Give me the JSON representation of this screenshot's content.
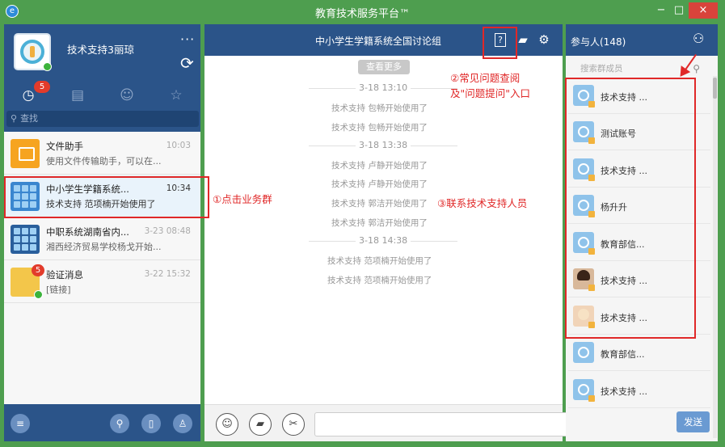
{
  "window": {
    "title": "教育技术服务平台™",
    "app_icon": "app-logo-icon",
    "controls": {
      "minimize": "−",
      "maximize": "□",
      "close": "×"
    },
    "accent_color": "#2b5489",
    "frame_color": "#4e9e4f"
  },
  "profile": {
    "name": "技术支持3丽琼",
    "more": "···",
    "refresh": "⟳"
  },
  "nav": {
    "tabs": [
      {
        "icon": "clock-icon",
        "glyph": "◷",
        "badge": "5"
      },
      {
        "icon": "list-icon",
        "glyph": "▤"
      },
      {
        "icon": "contacts-icon",
        "glyph": "☺"
      },
      {
        "icon": "star-icon",
        "glyph": "☆"
      }
    ]
  },
  "search": {
    "glyph": "⚲",
    "placeholder": "查找"
  },
  "conversations": [
    {
      "title": "文件助手",
      "snippet": "使用文件传输助手，可以在...",
      "time": "10:03",
      "icon": "file-helper-icon"
    },
    {
      "title": "中小学生学籍系统...",
      "snippet": "技术支持 范项楠开始使用了",
      "time": "10:34",
      "icon": "group-icon"
    },
    {
      "title": "中职系统湖南省内...",
      "snippet": "湘西经济贸易学校杨戈开始...",
      "time": "3-23 08:48",
      "icon": "group-icon"
    },
    {
      "title": "验证消息",
      "snippet": "[链接]",
      "time": "3-22 15:32",
      "icon": "verify-icon",
      "badge": "5"
    }
  ],
  "left_footer": {
    "buttons": [
      {
        "name": "menu-icon",
        "glyph": "≡"
      },
      {
        "name": "search-icon",
        "glyph": "⚲"
      },
      {
        "name": "phone-icon",
        "glyph": "▯"
      },
      {
        "name": "user-icon",
        "glyph": "♙"
      }
    ]
  },
  "chat": {
    "group_title": "中小学生学籍系统全国讨论组",
    "header_icons": [
      {
        "name": "faq-icon",
        "glyph": "?"
      },
      {
        "name": "folder-icon",
        "glyph": "▰"
      },
      {
        "name": "settings-icon",
        "glyph": "⚙"
      }
    ],
    "more_history": "查看更多",
    "timeline": [
      {
        "type": "time",
        "text": "3-18 13:10"
      },
      {
        "type": "msg",
        "text": "技术支持 包畅开始使用了"
      },
      {
        "type": "msg",
        "text": "技术支持 包畅开始使用了"
      },
      {
        "type": "time",
        "text": "3-18 13:38"
      },
      {
        "type": "msg",
        "text": "技术支持 卢静开始使用了"
      },
      {
        "type": "msg",
        "text": "技术支持 卢静开始使用了"
      },
      {
        "type": "msg",
        "text": "技术支持 郭洁开始使用了"
      },
      {
        "type": "msg",
        "text": "技术支持 郭洁开始使用了"
      },
      {
        "type": "time",
        "text": "3-18 14:38"
      },
      {
        "type": "msg",
        "text": "技术支持 范项楠开始使用了"
      },
      {
        "type": "msg",
        "text": "技术支持 范项楠开始使用了"
      }
    ],
    "tools": [
      {
        "name": "emoji-icon",
        "glyph": "☺"
      },
      {
        "name": "folder-icon",
        "glyph": "▰"
      },
      {
        "name": "scissors-icon",
        "glyph": "✂"
      }
    ],
    "input_value": "",
    "send_label": "发送"
  },
  "participants": {
    "title": "参与人(148)",
    "icon": "people-icon",
    "search_placeholder": "搜索群成员",
    "members": [
      {
        "name": "技术支持 ...",
        "avatar": "default"
      },
      {
        "name": "测试账号",
        "avatar": "default"
      },
      {
        "name": "技术支持 ...",
        "avatar": "default"
      },
      {
        "name": "杨升升",
        "avatar": "default"
      },
      {
        "name": "教育部信...",
        "avatar": "default"
      },
      {
        "name": "技术支持 ...",
        "avatar": "photo-female"
      },
      {
        "name": "技术支持 ...",
        "avatar": "photo-cartoon"
      },
      {
        "name": "教育部信...",
        "avatar": "default"
      },
      {
        "name": "技术支持 ...",
        "avatar": "default"
      }
    ]
  },
  "annotations": {
    "a1": "①点击业务群",
    "a2_line1": "②常见问题查阅",
    "a2_line2": "及\"问题提问\"入口",
    "a3": "③联系技术支持人员",
    "color": "#e02828"
  }
}
